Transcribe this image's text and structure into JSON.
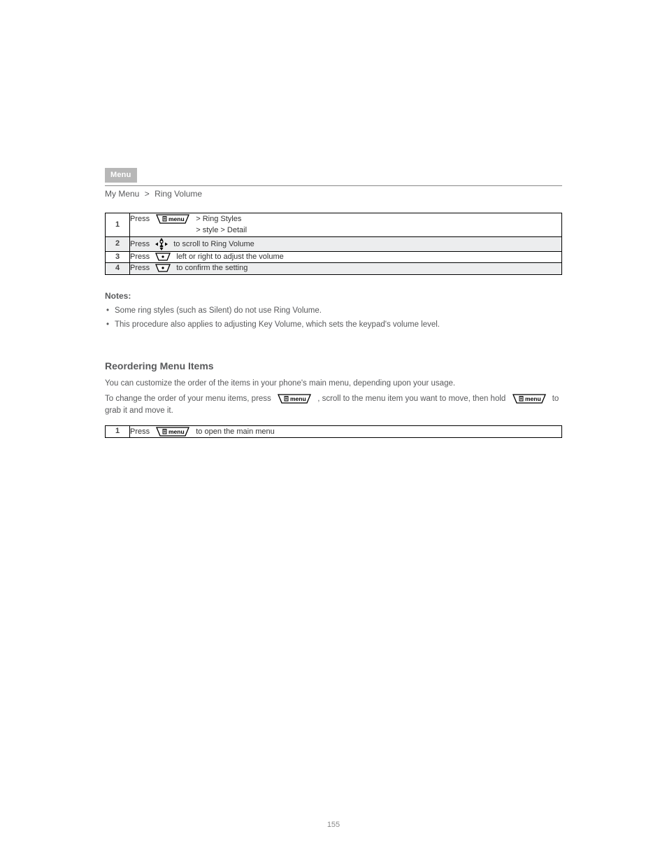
{
  "header": {
    "tab": "Menu",
    "crumbs": [
      "My Menu",
      "Ring Volume"
    ]
  },
  "table1": {
    "rows": [
      {
        "n": "1",
        "before": "Press ",
        "after_key": " > ",
        "trail": "Ring Styles",
        "sub": "> style > Detail"
      },
      {
        "n": "2",
        "before": "Press ",
        "trail": " to scroll to Ring Volume"
      },
      {
        "n": "3",
        "before": "Press ",
        "trail": " left or right to adjust the volume"
      },
      {
        "n": "4",
        "before": "Press ",
        "trail": " to confirm the setting"
      }
    ]
  },
  "notes": {
    "title": "Notes:",
    "items": [
      "Some ring styles (such as Silent) do not use Ring Volume.",
      "This procedure also applies to adjusting Key Volume, which sets the keypad's volume level."
    ]
  },
  "section": {
    "title": "Reordering Menu Items",
    "p1": "You can customize the order of the items in your phone's main menu, depending upon your usage.",
    "p2_before": "To change the order of your menu items, press ",
    "p2_after": ", scroll to the menu item you want to move, then hold ",
    "p2_tail": " to grab it and move it."
  },
  "table2": {
    "rows": [
      {
        "n": "1",
        "before": "Press ",
        "trail": " to open the main menu"
      }
    ]
  },
  "footer": "155"
}
